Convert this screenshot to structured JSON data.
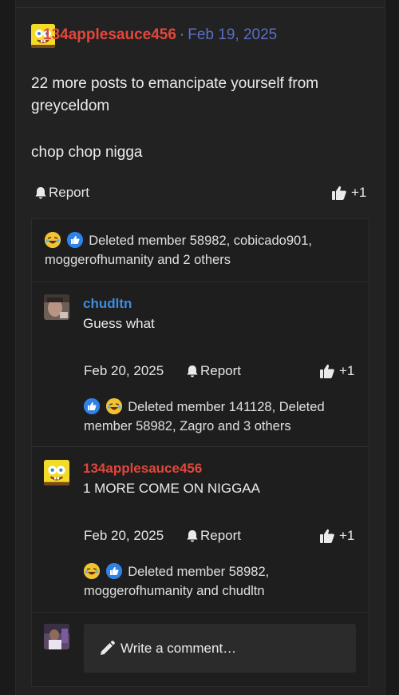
{
  "post": {
    "author": "134applesauce456",
    "separator": "·",
    "date": "Feb 19, 2025",
    "body_lines": [
      "22 more posts to emancipate yourself from greyceldom",
      "chop chop nigga"
    ],
    "report_label": "Report",
    "like_count": "+1",
    "reactions_summary": "Deleted member 58982, cobicado901, moggerofhumanity and 2 others"
  },
  "comments": [
    {
      "author": "chudltn",
      "author_color": "#3b8de0",
      "text": "Guess what",
      "date": "Feb 20, 2025",
      "report_label": "Report",
      "like_count": "+1",
      "reactions_summary": "Deleted member 141128, Deleted member 58982, Zagro and 3 others"
    },
    {
      "author": "134applesauce456",
      "author_color": "#e2473b",
      "text": "1 MORE COME ON NIGGAA",
      "date": "Feb 20, 2025",
      "report_label": "Report",
      "like_count": "+1",
      "reactions_summary": "Deleted member 58982, moggerofhumanity and chudltn"
    }
  ],
  "composer": {
    "placeholder": "Write a comment…"
  },
  "colors": {
    "username_red": "#e2473b",
    "date_blue": "#5b6fc6",
    "link_blue": "#3b8de0"
  },
  "icons": {
    "report": "bell-icon",
    "like": "thumbs-up-icon",
    "write": "pencil-icon",
    "reaction_like": "like-reaction-icon",
    "reaction_laugh": "laughing-reaction-icon"
  }
}
